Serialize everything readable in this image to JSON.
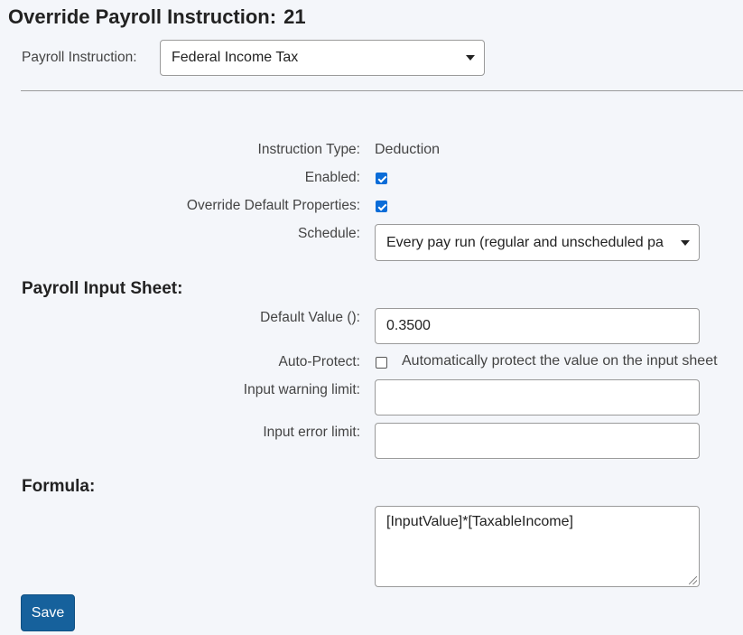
{
  "page": {
    "title": "Override Payroll Instruction:",
    "instruction_number": "21"
  },
  "payroll_instruction": {
    "label": "Payroll Instruction:",
    "selected": "Federal Income Tax"
  },
  "details": {
    "instruction_type_label": "Instruction Type:",
    "instruction_type_value": "Deduction",
    "enabled_label": "Enabled:",
    "enabled_checked": true,
    "override_label": "Override Default Properties:",
    "override_checked": true,
    "schedule_label": "Schedule:",
    "schedule_selected": "Every pay run (regular and unscheduled pa"
  },
  "input_sheet": {
    "heading": "Payroll Input Sheet:",
    "default_value_label": "Default Value ():",
    "default_value": "0.3500",
    "auto_protect_label": "Auto-Protect:",
    "auto_protect_checked": false,
    "auto_protect_text": "Automatically protect the value on the input sheet",
    "warning_limit_label": "Input warning limit:",
    "warning_limit_value": "",
    "error_limit_label": "Input error limit:",
    "error_limit_value": ""
  },
  "formula": {
    "heading": "Formula:",
    "value": "[InputValue]*[TaxableIncome]"
  },
  "actions": {
    "save_label": "Save"
  },
  "colors": {
    "background": "#f4f6fa",
    "checkbox_accent": "#0a6cd8",
    "save_button": "#16619c"
  },
  "icons": {
    "dropdown": "caret-down-icon",
    "checkbox_checked": "checkmark-icon"
  }
}
